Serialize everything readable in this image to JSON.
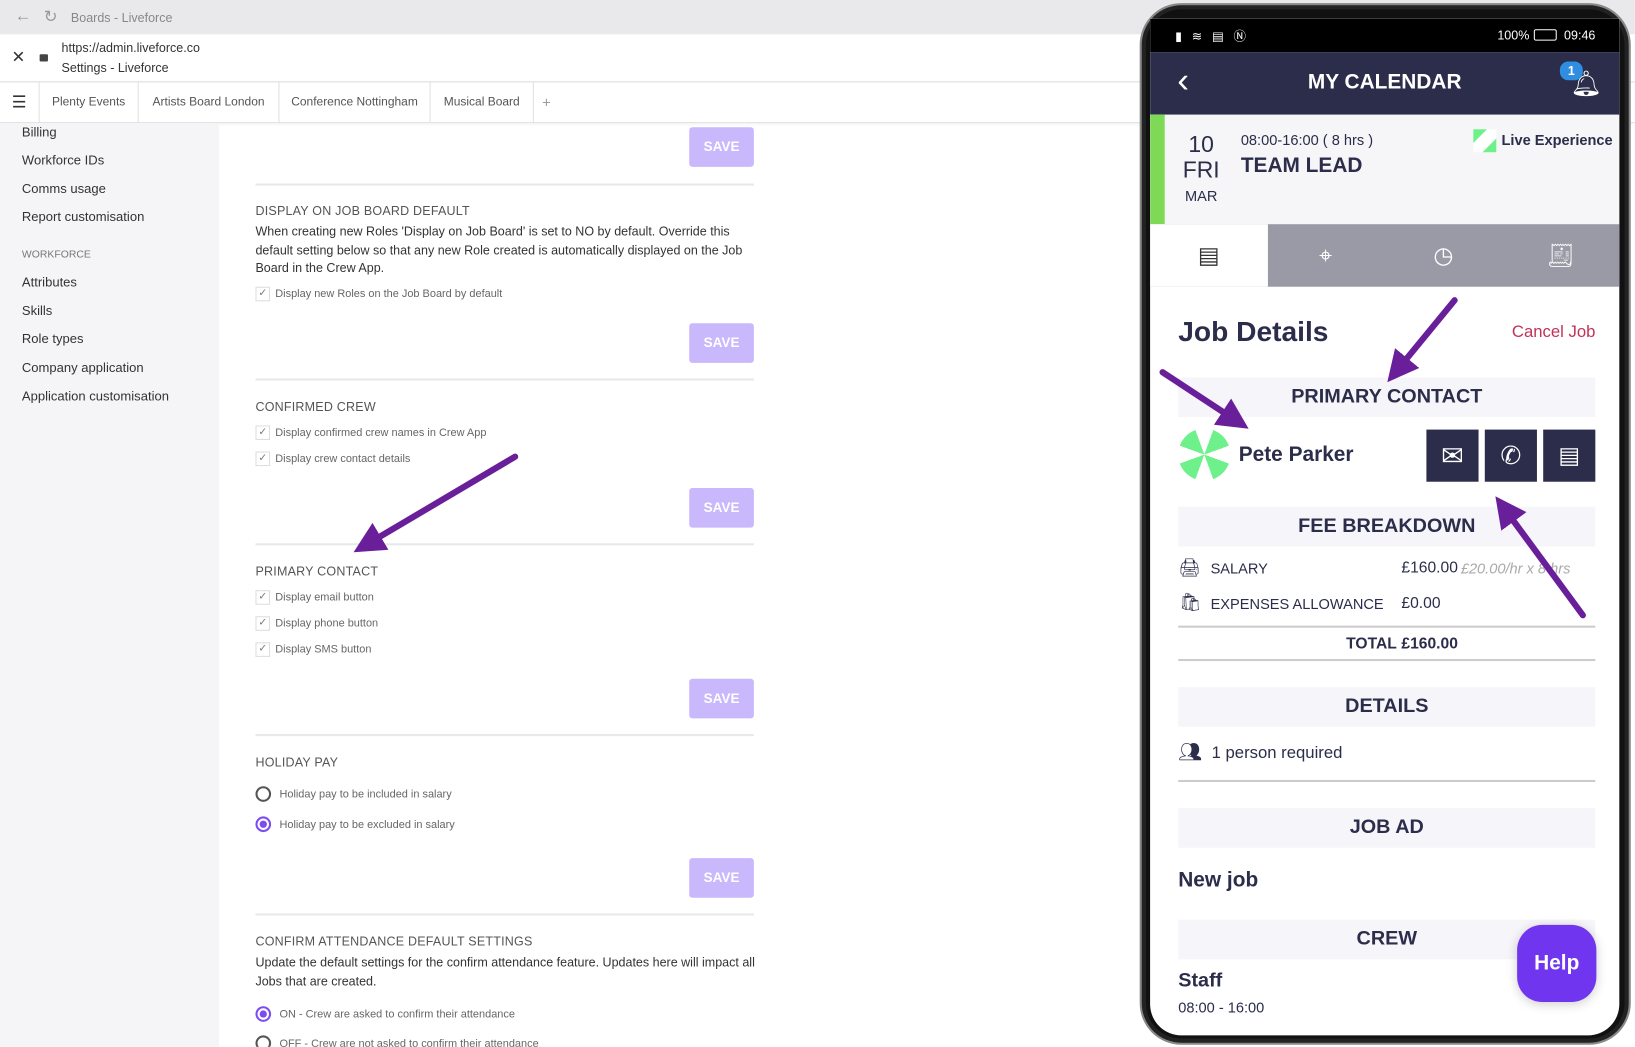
{
  "browser": {
    "tab_title": "Boards - Liveforce",
    "url": "https://admin.liveforce.co",
    "page_title": "Settings - Liveforce"
  },
  "board_tabs": [
    "Plenty Events",
    "Artists Board London",
    "Conference Nottingham",
    "Musical Board"
  ],
  "add_tab": "+",
  "sidebar": {
    "items_top": [
      "Billing",
      "Workforce IDs",
      "Comms usage",
      "Report customisation"
    ],
    "workforce_heading": "WORKFORCE",
    "items_workforce": [
      "Attributes",
      "Skills",
      "Role types",
      "Company application",
      "Application customisation"
    ]
  },
  "save_label": "SAVE",
  "sections": {
    "job_board": {
      "title": "DISPLAY ON JOB BOARD DEFAULT",
      "desc": "When creating new Roles 'Display on Job Board' is set to NO by default. Override this default setting below so that any new Role created is automatically displayed on the Job Board in the Crew App.",
      "checkbox": "Display new Roles on the Job Board by default"
    },
    "confirmed_crew": {
      "title": "CONFIRMED CREW",
      "checkboxes": [
        "Display confirmed crew names in Crew App",
        "Display crew contact details"
      ]
    },
    "primary_contact": {
      "title": "PRIMARY CONTACT",
      "checkboxes": [
        "Display email button",
        "Display phone button",
        "Display SMS button"
      ]
    },
    "holiday_pay": {
      "title": "HOLIDAY PAY",
      "options": [
        "Holiday pay to be included in salary",
        "Holiday pay to be excluded in salary"
      ],
      "selected": 1
    },
    "confirm_attendance": {
      "title": "CONFIRM ATTENDANCE DEFAULT SETTINGS",
      "desc": "Update the default settings for the confirm attendance feature. Updates here will impact all Jobs that are created.",
      "options": [
        "ON - Crew are asked to confirm their attendance",
        "OFF - Crew are not asked to confirm their attendance"
      ],
      "selected": 0
    }
  },
  "phone": {
    "battery": "100%",
    "time": "09:46",
    "header_title": "MY CALENDAR",
    "notif_count": "1",
    "date_day": "10",
    "date_weekday": "FRI",
    "date_month": "MAR",
    "shift_time": "08:00-16:00 ( 8 hrs )",
    "role": "TEAM LEAD",
    "company": "Live Experience",
    "job_details": "Job Details",
    "cancel_job": "Cancel Job",
    "primary_contact": "PRIMARY CONTACT",
    "contact_name": "Pete Parker",
    "fee_breakdown": "FEE BREAKDOWN",
    "salary_label": "SALARY",
    "salary_value": "£160.00",
    "salary_rate": "£20.00/hr x 8 hrs",
    "expenses_label": "EXPENSES ALLOWANCE",
    "expenses_value": "£0.00",
    "total_label": "TOTAL",
    "total_value": "£160.00",
    "details": "DETAILS",
    "people": "1 person required",
    "job_ad": "JOB AD",
    "job_ad_text": "New job",
    "crew": "CREW",
    "crew_role": "Staff",
    "crew_time": "08:00 - 16:00",
    "help": "Help"
  },
  "colors": {
    "accent": "#7b4cf0",
    "save_disabled": "#c9b8fb",
    "navy": "#2b2d4a",
    "arrow": "#6a1f9a",
    "green": "#7ed957"
  }
}
